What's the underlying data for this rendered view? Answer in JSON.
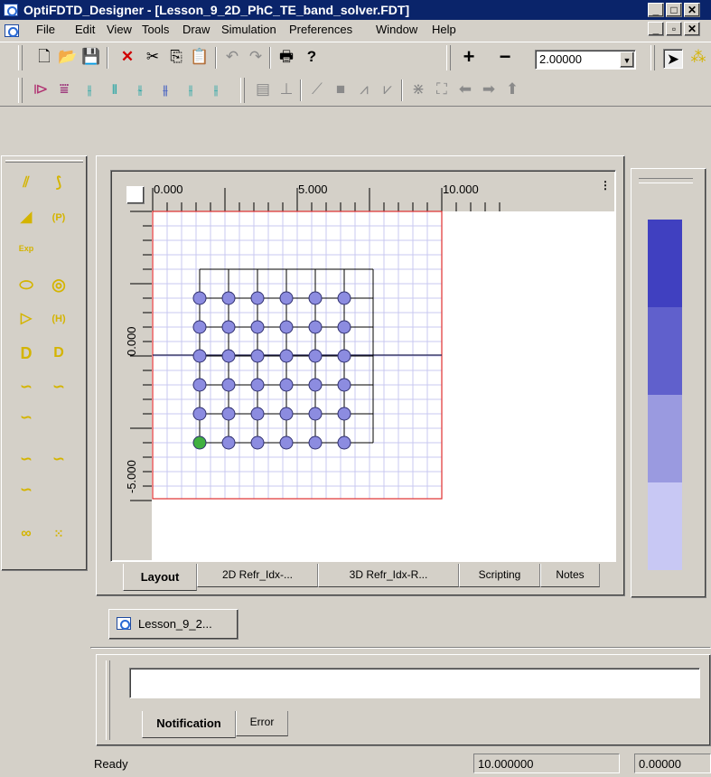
{
  "window": {
    "title": "OptiFDTD_Designer - [Lesson_9_2D_PhC_TE_band_solver.FDT]"
  },
  "menu": [
    "File",
    "Edit",
    "View",
    "Tools",
    "Draw",
    "Simulation",
    "Preferences",
    "Window",
    "Help"
  ],
  "toolbar": {
    "zoom_value": "2.00000"
  },
  "ruler": {
    "top_labels": [
      "0.000",
      "5.000",
      "10.000"
    ],
    "left_labels": [
      "0.000",
      "-5.000"
    ]
  },
  "layout_tabs": [
    "Layout",
    "2D Refr_Idx-...",
    "3D Refr_Idx-R...",
    "Scripting",
    "Notes"
  ],
  "doc_tab": "Lesson_9_2...",
  "output_tabs": [
    "Notification",
    "Error"
  ],
  "status": {
    "text": "Ready",
    "x_value": "10.000000",
    "y_value": "0.00000"
  },
  "lattice": {
    "rows": 6,
    "cols": 6,
    "selected": "bottom-left"
  },
  "colors": {
    "title_bg": "#0a246a",
    "boundary": "#e03030",
    "rod_fill": "#8c8ce0",
    "grid": "#c8c8f0",
    "scale": [
      "#4040c0",
      "#6060cc",
      "#9a9ae0",
      "#c8c8f4"
    ]
  }
}
